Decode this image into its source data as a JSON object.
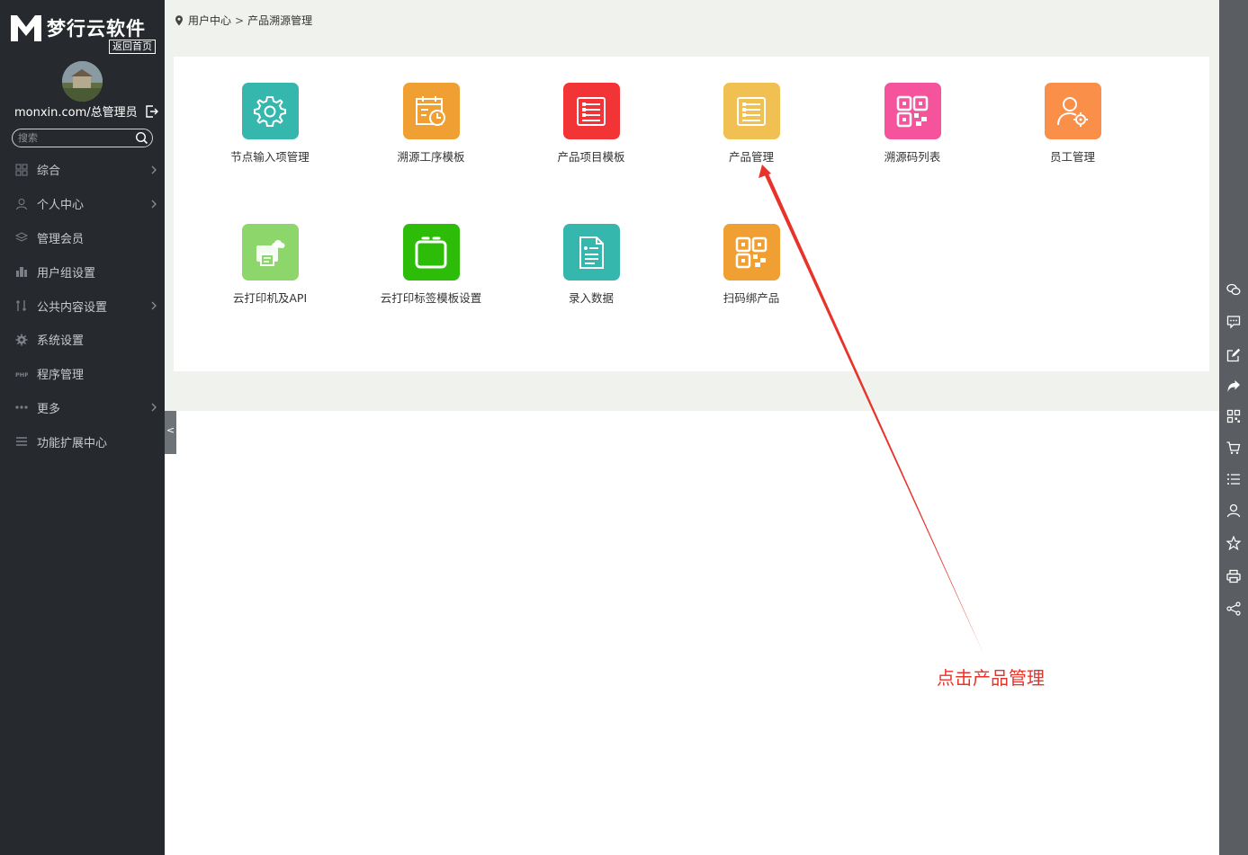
{
  "sidebar": {
    "logo_text": "梦行云软件",
    "home_link": "返回首页",
    "user": "monxin.com/总管理员",
    "search_placeholder": "搜索",
    "menu": [
      {
        "label": "综合",
        "icon": "grid-icon",
        "has_arrow": true
      },
      {
        "label": "个人中心",
        "icon": "user-icon",
        "has_arrow": true
      },
      {
        "label": "管理会员",
        "icon": "layers-icon",
        "has_arrow": false
      },
      {
        "label": "用户组设置",
        "icon": "building-icon",
        "has_arrow": false
      },
      {
        "label": "公共内容设置",
        "icon": "tools-icon",
        "has_arrow": true
      },
      {
        "label": "系统设置",
        "icon": "gear-icon",
        "has_arrow": false
      },
      {
        "label": "程序管理",
        "icon": "php-icon",
        "has_arrow": false
      },
      {
        "label": "更多",
        "icon": "dots-icon",
        "has_arrow": true
      },
      {
        "label": "功能扩展中心",
        "icon": "list-icon",
        "has_arrow": false
      }
    ],
    "collapse_label": "<"
  },
  "breadcrumb": {
    "root": "用户中心",
    "current": "产品溯源管理",
    "sep": ">"
  },
  "tiles": [
    {
      "label": "节点输入项管理",
      "color": "#35b7ae",
      "icon": "gear-icon"
    },
    {
      "label": "溯源工序模板",
      "color": "#f0a033",
      "icon": "calendar-clock-icon"
    },
    {
      "label": "产品项目模板",
      "color": "#f23437",
      "icon": "list-form-icon"
    },
    {
      "label": "产品管理",
      "color": "#f0c052",
      "icon": "list-form-icon"
    },
    {
      "label": "溯源码列表",
      "color": "#f5549d",
      "icon": "qrcode-icon"
    },
    {
      "label": "员工管理",
      "color": "#f98f48",
      "icon": "user-gear-icon"
    },
    {
      "label": "云打印机及API",
      "color": "#8dd66b",
      "icon": "cloud-printer-icon"
    },
    {
      "label": "云打印标签模板设置",
      "color": "#2dbd09",
      "icon": "label-frame-icon"
    },
    {
      "label": "录入数据",
      "color": "#35b7ae",
      "icon": "document-icon"
    },
    {
      "label": "扫码绑产品",
      "color": "#f0a033",
      "icon": "qrcode-icon"
    }
  ],
  "annotation": {
    "text": "点击产品管理",
    "color": "#e8332b"
  },
  "rightbar": [
    "wechat-icon",
    "message-icon",
    "edit-icon",
    "share-arrow-icon",
    "qrcode-icon",
    "cart-icon",
    "list-icon",
    "user-icon",
    "star-icon",
    "print-icon",
    "share-icon"
  ]
}
